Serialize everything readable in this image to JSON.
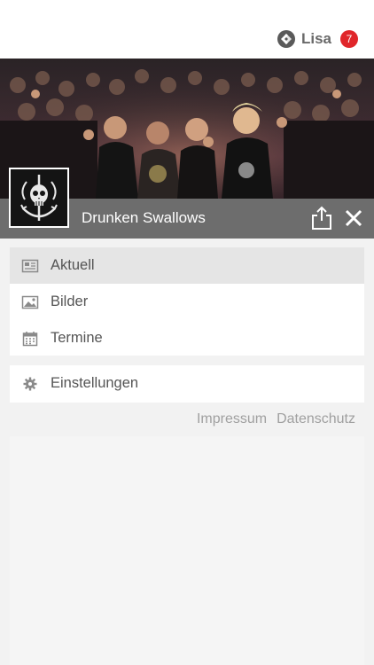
{
  "header": {
    "user_name": "Lisa",
    "notification_count": "7",
    "logo_icon": "app-logo-icon"
  },
  "band": {
    "name": "Drunken Swallows",
    "share_icon": "share-icon",
    "close_icon": "close-icon",
    "avatar_icon": "skull-anchor-logo"
  },
  "menu": {
    "items": [
      {
        "label": "Aktuell",
        "icon": "newspaper-icon",
        "active": true
      },
      {
        "label": "Bilder",
        "icon": "image-icon",
        "active": false
      },
      {
        "label": "Termine",
        "icon": "calendar-icon",
        "active": false
      }
    ],
    "settings": {
      "label": "Einstellungen",
      "icon": "gear-icon"
    }
  },
  "footer": {
    "impressum": "Impressum",
    "datenschutz": "Datenschutz"
  },
  "colors": {
    "badge": "#e0262a",
    "band_bar": "#6d6d6d",
    "active_item": "#e5e5e5"
  }
}
